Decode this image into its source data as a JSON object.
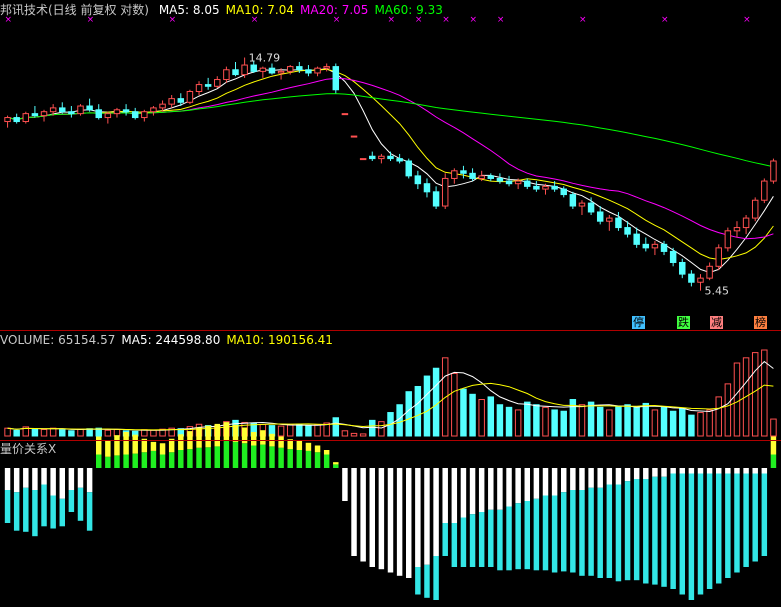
{
  "app": {
    "main_title": "邦讯技术(日线 前复权 对数)",
    "ma": [
      {
        "label": "MA5:",
        "value": "8.05",
        "color": "#ffffff"
      },
      {
        "label": "MA10:",
        "value": "7.04",
        "color": "#ffff00"
      },
      {
        "label": "MA20:",
        "value": "7.05",
        "color": "#ff00ff"
      },
      {
        "label": "MA60:",
        "value": "9.33",
        "color": "#00ff00"
      }
    ],
    "volume": [
      {
        "label": "VOLUME:",
        "value": "65154.57",
        "color": "#c8c8c8"
      },
      {
        "label": "MA5:",
        "value": "244598.80",
        "color": "#ffffff"
      },
      {
        "label": "MA10:",
        "value": "190156.41",
        "color": "#ffff00"
      }
    ],
    "indicator_title": "量价关系X",
    "high_label": "14.79",
    "low_label": "5.45",
    "tags": [
      {
        "text": "停",
        "color": "#40c0ff"
      },
      {
        "text": "跌",
        "color": "#40ff40"
      },
      {
        "text": "减",
        "color": "#ff8080"
      },
      {
        "text": "榜",
        "color": "#ff8040"
      }
    ]
  },
  "chart_data": {
    "type": "candlestick",
    "scale": "log",
    "price_ylim": [
      4.6,
      17.5
    ],
    "candles": [
      [
        11.1,
        11.4,
        10.8,
        11.3
      ],
      [
        11.3,
        11.5,
        11.0,
        11.1
      ],
      [
        11.1,
        11.6,
        11.0,
        11.5
      ],
      [
        11.5,
        11.9,
        11.3,
        11.4
      ],
      [
        11.4,
        11.7,
        11.1,
        11.6
      ],
      [
        11.6,
        12.0,
        11.4,
        11.8
      ],
      [
        11.8,
        12.1,
        11.5,
        11.6
      ],
      [
        11.6,
        11.9,
        11.3,
        11.5
      ],
      [
        11.5,
        12.0,
        11.4,
        11.9
      ],
      [
        11.9,
        12.3,
        11.6,
        11.7
      ],
      [
        11.7,
        12.0,
        11.2,
        11.3
      ],
      [
        11.3,
        11.6,
        11.0,
        11.5
      ],
      [
        11.5,
        11.8,
        11.3,
        11.7
      ],
      [
        11.7,
        12.0,
        11.4,
        11.6
      ],
      [
        11.6,
        11.8,
        11.2,
        11.3
      ],
      [
        11.3,
        11.7,
        11.1,
        11.6
      ],
      [
        11.6,
        11.9,
        11.4,
        11.8
      ],
      [
        11.8,
        12.2,
        11.6,
        12.0
      ],
      [
        12.0,
        12.5,
        11.8,
        12.3
      ],
      [
        12.3,
        12.6,
        11.9,
        12.1
      ],
      [
        12.1,
        12.8,
        12.0,
        12.7
      ],
      [
        12.7,
        13.3,
        12.5,
        13.1
      ],
      [
        13.1,
        13.5,
        12.8,
        13.0
      ],
      [
        13.0,
        13.6,
        12.9,
        13.4
      ],
      [
        13.4,
        14.2,
        13.2,
        14.0
      ],
      [
        14.0,
        14.5,
        13.6,
        13.7
      ],
      [
        13.7,
        14.79,
        13.5,
        14.3
      ],
      [
        14.3,
        14.6,
        13.8,
        13.9
      ],
      [
        13.9,
        14.2,
        13.5,
        14.1
      ],
      [
        14.1,
        14.4,
        13.7,
        13.8
      ],
      [
        13.8,
        14.1,
        13.4,
        13.9
      ],
      [
        13.9,
        14.3,
        13.7,
        14.2
      ],
      [
        14.2,
        14.5,
        13.8,
        14.0
      ],
      [
        14.0,
        14.3,
        13.6,
        13.8
      ],
      [
        13.8,
        14.2,
        13.6,
        14.1
      ],
      [
        14.1,
        14.4,
        13.9,
        14.2
      ],
      [
        14.2,
        14.4,
        12.6,
        12.8
      ],
      [
        11.5,
        11.5,
        11.5,
        11.5
      ],
      [
        10.4,
        10.4,
        10.4,
        10.4
      ],
      [
        9.4,
        9.4,
        9.4,
        9.4
      ],
      [
        9.5,
        9.7,
        9.3,
        9.4
      ],
      [
        9.4,
        9.6,
        9.2,
        9.5
      ],
      [
        9.5,
        9.7,
        9.3,
        9.4
      ],
      [
        9.4,
        9.6,
        9.2,
        9.3
      ],
      [
        9.3,
        9.4,
        8.6,
        8.7
      ],
      [
        8.7,
        8.9,
        8.2,
        8.4
      ],
      [
        8.4,
        8.6,
        7.9,
        8.1
      ],
      [
        8.1,
        8.3,
        7.5,
        7.6
      ],
      [
        7.6,
        8.8,
        7.5,
        8.6
      ],
      [
        8.6,
        9.0,
        8.4,
        8.9
      ],
      [
        8.9,
        9.1,
        8.6,
        8.8
      ],
      [
        8.8,
        9.0,
        8.5,
        8.6
      ],
      [
        8.6,
        8.9,
        8.5,
        8.7
      ],
      [
        8.7,
        8.8,
        8.5,
        8.6
      ],
      [
        8.6,
        8.8,
        8.4,
        8.5
      ],
      [
        8.5,
        8.7,
        8.3,
        8.4
      ],
      [
        8.4,
        8.6,
        8.2,
        8.5
      ],
      [
        8.5,
        8.6,
        8.2,
        8.3
      ],
      [
        8.3,
        8.5,
        8.1,
        8.2
      ],
      [
        8.2,
        8.4,
        8.0,
        8.3
      ],
      [
        8.3,
        8.5,
        8.1,
        8.2
      ],
      [
        8.2,
        8.3,
        7.9,
        8.0
      ],
      [
        8.0,
        8.1,
        7.5,
        7.6
      ],
      [
        7.6,
        7.8,
        7.3,
        7.7
      ],
      [
        7.7,
        7.9,
        7.3,
        7.4
      ],
      [
        7.4,
        7.6,
        7.0,
        7.1
      ],
      [
        7.1,
        7.3,
        6.8,
        7.2
      ],
      [
        7.2,
        7.4,
        6.8,
        6.9
      ],
      [
        6.9,
        7.1,
        6.6,
        6.7
      ],
      [
        6.7,
        6.9,
        6.3,
        6.4
      ],
      [
        6.4,
        6.6,
        6.2,
        6.3
      ],
      [
        6.3,
        6.5,
        6.1,
        6.4
      ],
      [
        6.4,
        6.5,
        6.1,
        6.2
      ],
      [
        6.2,
        6.3,
        5.8,
        5.9
      ],
      [
        5.9,
        6.0,
        5.5,
        5.6
      ],
      [
        5.6,
        5.7,
        5.3,
        5.4
      ],
      [
        5.4,
        5.6,
        5.2,
        5.5
      ],
      [
        5.5,
        5.9,
        5.45,
        5.8
      ],
      [
        5.8,
        6.4,
        5.7,
        6.3
      ],
      [
        6.3,
        6.9,
        6.2,
        6.8
      ],
      [
        6.8,
        7.1,
        6.6,
        6.9
      ],
      [
        6.9,
        7.3,
        6.7,
        7.2
      ],
      [
        7.2,
        7.9,
        7.1,
        7.8
      ],
      [
        7.8,
        8.6,
        7.7,
        8.5
      ],
      [
        8.5,
        9.4,
        8.4,
        9.3
      ]
    ],
    "volume": [
      30,
      22,
      35,
      28,
      25,
      30,
      24,
      20,
      26,
      28,
      30,
      22,
      25,
      20,
      18,
      24,
      22,
      26,
      30,
      28,
      36,
      45,
      40,
      38,
      55,
      60,
      52,
      48,
      44,
      40,
      38,
      42,
      45,
      40,
      42,
      50,
      70,
      20,
      10,
      8,
      60,
      55,
      90,
      120,
      170,
      190,
      230,
      260,
      300,
      240,
      180,
      160,
      140,
      150,
      120,
      110,
      100,
      130,
      120,
      110,
      100,
      95,
      140,
      120,
      130,
      110,
      100,
      115,
      120,
      110,
      125,
      100,
      110,
      95,
      105,
      80,
      90,
      100,
      150,
      200,
      280,
      300,
      320,
      330,
      65
    ],
    "indicator": [
      [
        20,
        30,
        0,
        0
      ],
      [
        22,
        35,
        0,
        0
      ],
      [
        18,
        40,
        0,
        0
      ],
      [
        20,
        42,
        0,
        0
      ],
      [
        15,
        38,
        0,
        0
      ],
      [
        25,
        30,
        0,
        0
      ],
      [
        28,
        25,
        0,
        0
      ],
      [
        20,
        20,
        0,
        0
      ],
      [
        18,
        30,
        0,
        0
      ],
      [
        22,
        35,
        0,
        0
      ],
      [
        0,
        0,
        40,
        30
      ],
      [
        0,
        0,
        35,
        25
      ],
      [
        0,
        0,
        45,
        28
      ],
      [
        0,
        0,
        50,
        30
      ],
      [
        0,
        0,
        42,
        32
      ],
      [
        0,
        0,
        30,
        35
      ],
      [
        0,
        0,
        20,
        38
      ],
      [
        0,
        0,
        25,
        30
      ],
      [
        0,
        0,
        30,
        35
      ],
      [
        0,
        0,
        35,
        40
      ],
      [
        0,
        0,
        40,
        42
      ],
      [
        0,
        0,
        45,
        45
      ],
      [
        0,
        0,
        48,
        46
      ],
      [
        0,
        0,
        50,
        48
      ],
      [
        0,
        0,
        42,
        60
      ],
      [
        0,
        0,
        38,
        58
      ],
      [
        0,
        0,
        35,
        55
      ],
      [
        0,
        0,
        30,
        50
      ],
      [
        0,
        0,
        32,
        52
      ],
      [
        0,
        0,
        28,
        48
      ],
      [
        0,
        0,
        25,
        45
      ],
      [
        0,
        0,
        22,
        42
      ],
      [
        0,
        0,
        20,
        40
      ],
      [
        0,
        0,
        18,
        38
      ],
      [
        0,
        0,
        15,
        35
      ],
      [
        0,
        0,
        10,
        30
      ],
      [
        0,
        0,
        5,
        8
      ],
      [
        30,
        0,
        0,
        0
      ],
      [
        80,
        0,
        0,
        0
      ],
      [
        85,
        0,
        0,
        0
      ],
      [
        90,
        0,
        0,
        0
      ],
      [
        92,
        0,
        0,
        0
      ],
      [
        95,
        0,
        0,
        0
      ],
      [
        98,
        0,
        0,
        0
      ],
      [
        100,
        0,
        0,
        0
      ],
      [
        90,
        25,
        0,
        0
      ],
      [
        88,
        30,
        0,
        0
      ],
      [
        80,
        40,
        0,
        0
      ],
      [
        50,
        30,
        0,
        0
      ],
      [
        50,
        40,
        0,
        0
      ],
      [
        45,
        45,
        0,
        0
      ],
      [
        42,
        48,
        0,
        0
      ],
      [
        40,
        50,
        0,
        0
      ],
      [
        38,
        52,
        0,
        0
      ],
      [
        38,
        55,
        0,
        0
      ],
      [
        35,
        58,
        0,
        0
      ],
      [
        32,
        60,
        0,
        0
      ],
      [
        30,
        62,
        0,
        0
      ],
      [
        28,
        65,
        0,
        0
      ],
      [
        25,
        68,
        0,
        0
      ],
      [
        25,
        70,
        0,
        0
      ],
      [
        22,
        72,
        0,
        0
      ],
      [
        20,
        75,
        0,
        0
      ],
      [
        20,
        78,
        0,
        0
      ],
      [
        18,
        80,
        0,
        0
      ],
      [
        18,
        82,
        0,
        0
      ],
      [
        15,
        85,
        0,
        0
      ],
      [
        15,
        88,
        0,
        0
      ],
      [
        12,
        90,
        0,
        0
      ],
      [
        10,
        92,
        0,
        0
      ],
      [
        10,
        95,
        0,
        0
      ],
      [
        8,
        98,
        0,
        0
      ],
      [
        8,
        100,
        0,
        0
      ],
      [
        5,
        105,
        0,
        0
      ],
      [
        5,
        110,
        0,
        0
      ],
      [
        5,
        115,
        0,
        0
      ],
      [
        5,
        110,
        0,
        0
      ],
      [
        5,
        105,
        0,
        0
      ],
      [
        5,
        100,
        0,
        0
      ],
      [
        5,
        95,
        0,
        0
      ],
      [
        5,
        90,
        0,
        0
      ],
      [
        5,
        85,
        0,
        0
      ],
      [
        5,
        80,
        0,
        0
      ],
      [
        5,
        75,
        0,
        0
      ],
      [
        0,
        0,
        40,
        30
      ]
    ]
  }
}
